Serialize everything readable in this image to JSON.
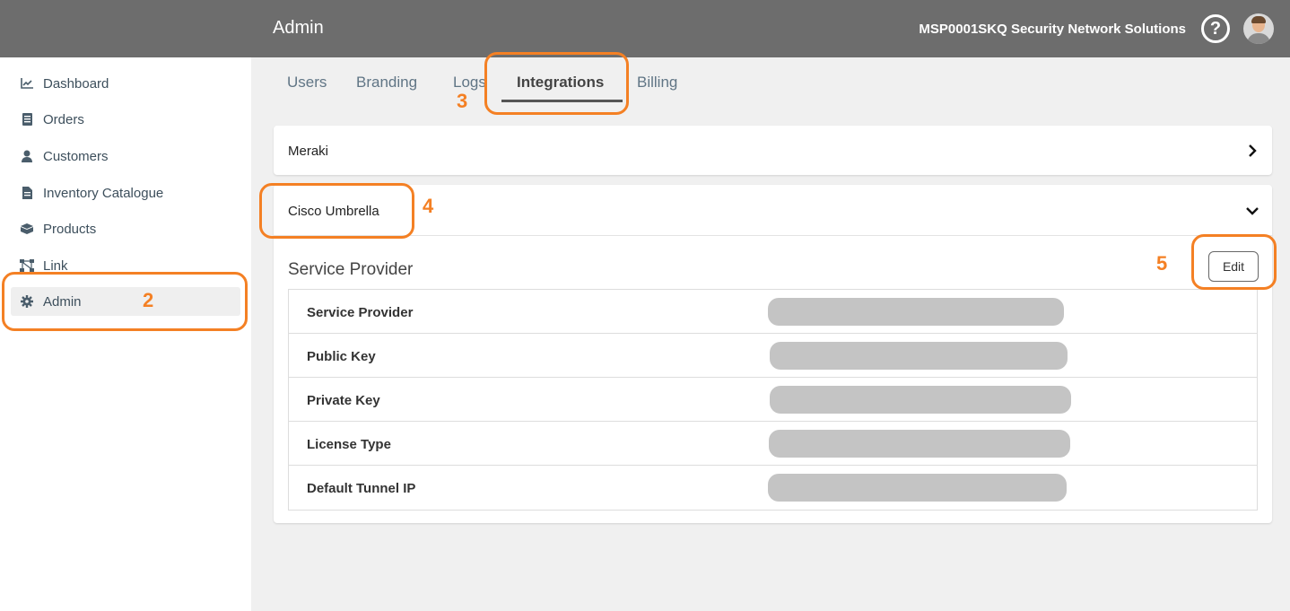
{
  "header": {
    "title": "Admin",
    "org": "MSP0001SKQ  Security Network Solutions",
    "help_icon": "help-circle-icon",
    "avatar_icon": "user-avatar-icon"
  },
  "sidebar": {
    "items": [
      {
        "label": "Dashboard",
        "icon": "chart-line-icon"
      },
      {
        "label": "Orders",
        "icon": "clipboard-icon"
      },
      {
        "label": "Customers",
        "icon": "user-icon"
      },
      {
        "label": "Inventory Catalogue",
        "icon": "document-icon"
      },
      {
        "label": "Products",
        "icon": "box-icon"
      },
      {
        "label": "Link",
        "icon": "network-icon"
      },
      {
        "label": "Admin",
        "icon": "gear-icon"
      }
    ]
  },
  "tabs": [
    "Users",
    "Branding",
    "Logs",
    "Integrations",
    "Billing"
  ],
  "integrations": {
    "meraki": {
      "label": "Meraki"
    },
    "umbrella": {
      "label": "Cisco Umbrella",
      "section_title": "Service Provider",
      "edit_label": "Edit",
      "fields": [
        "Service Provider",
        "Public Key",
        "Private Key",
        "License Type",
        "Default Tunnel IP"
      ]
    }
  },
  "annotations": [
    "2",
    "3",
    "4",
    "5"
  ],
  "colors": {
    "accent": "#f48024",
    "topbar": "#6d6d6d",
    "redacted": "#c4c4c4"
  }
}
